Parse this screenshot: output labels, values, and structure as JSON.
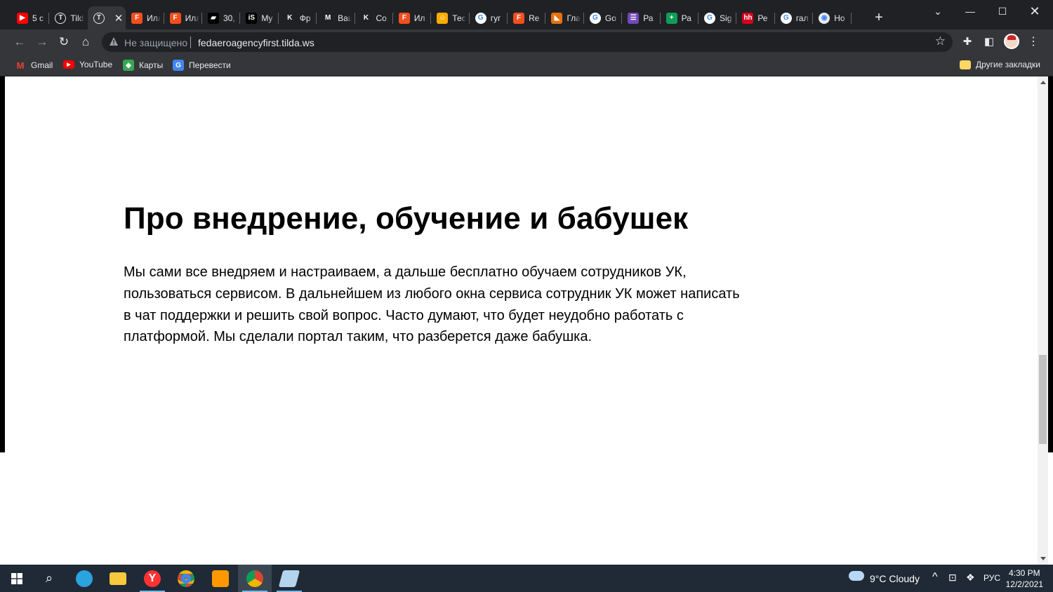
{
  "tabs": [
    {
      "title": "5 c",
      "icon": "youtube-icon",
      "color": "#ff0000",
      "glyph": "▶"
    },
    {
      "title": "Tilda",
      "icon": "tilda-icon",
      "color": "#3c4043",
      "glyph": "T"
    },
    {
      "title": "",
      "icon": "tilda-icon",
      "color": "#3c4043",
      "glyph": "T",
      "active": true
    },
    {
      "title": "Иллюстрации",
      "icon": "figma-icon",
      "color": "#f24e1e",
      "glyph": "F"
    },
    {
      "title": "Иллюстрации",
      "icon": "figma-icon",
      "color": "#f24e1e",
      "glyph": "F"
    },
    {
      "title": "30,",
      "icon": "black-square-icon",
      "color": "#000000",
      "glyph": "▰"
    },
    {
      "title": "My",
      "icon": "is-icon",
      "color": "#000000",
      "glyph": "iS"
    },
    {
      "title": "Фр",
      "icon": "k-icon",
      "color": "#202124",
      "glyph": "K"
    },
    {
      "title": "Ваш",
      "icon": "gmail-icon",
      "color": "#202124",
      "glyph": "M"
    },
    {
      "title": "Со",
      "icon": "k-icon",
      "color": "#202124",
      "glyph": "K"
    },
    {
      "title": "Ил",
      "icon": "figma-icon",
      "color": "#f24e1e",
      "glyph": "F"
    },
    {
      "title": "Тес",
      "icon": "emoji-icon",
      "color": "#f9ab00",
      "glyph": "☺"
    },
    {
      "title": "гуг",
      "icon": "google-icon",
      "color": "#ffffff",
      "glyph": "G"
    },
    {
      "title": "Re",
      "icon": "figma-icon",
      "color": "#f24e1e",
      "glyph": "F"
    },
    {
      "title": "Гла",
      "icon": "orange-icon",
      "color": "#e8710a",
      "glyph": "◣"
    },
    {
      "title": "Go",
      "icon": "google-icon",
      "color": "#ffffff",
      "glyph": "G"
    },
    {
      "title": "Ра",
      "icon": "forms-icon",
      "color": "#7248b9",
      "glyph": "☰"
    },
    {
      "title": "Ра",
      "icon": "sheets-plus-icon",
      "color": "#0f9d58",
      "glyph": "+"
    },
    {
      "title": "Sig",
      "icon": "google-icon",
      "color": "#ffffff",
      "glyph": "G"
    },
    {
      "title": "Ре",
      "icon": "hh-icon",
      "color": "#d6001c",
      "glyph": "hh"
    },
    {
      "title": "гал",
      "icon": "google-icon",
      "color": "#ffffff",
      "glyph": "G"
    },
    {
      "title": "Но",
      "icon": "chrome-icon",
      "color": "#e8eaed",
      "glyph": "◉"
    }
  ],
  "toolbar": {
    "security_label": "Не защищено",
    "url": "fedaeroagencyfirst.tilda.ws"
  },
  "bookmarks": [
    {
      "label": "Gmail",
      "icon": "gmail-icon"
    },
    {
      "label": "YouTube",
      "icon": "youtube-icon"
    },
    {
      "label": "Карты",
      "icon": "maps-icon"
    },
    {
      "label": "Перевести",
      "icon": "translate-icon"
    }
  ],
  "other_bookmarks": "Другие закладки",
  "page": {
    "heading": "Про внедрение, обучение и бабушек",
    "paragraph": "Мы сами все внедряем и настраиваем, а дальше бесплатно обучаем сотрудников УК, пользоваться сервисом. В дальнейшем из любого окна сервиса сотрудник УК может написать в чат поддержки и решить свой вопрос. Часто думают, что будет неудобно работать с платформой. Мы сделали портал таким, что разберется даже бабушка."
  },
  "taskbar": {
    "weather": "9°C  Cloudy",
    "lang": "РУС",
    "time": "4:30 PM",
    "date": "12/2/2021"
  }
}
